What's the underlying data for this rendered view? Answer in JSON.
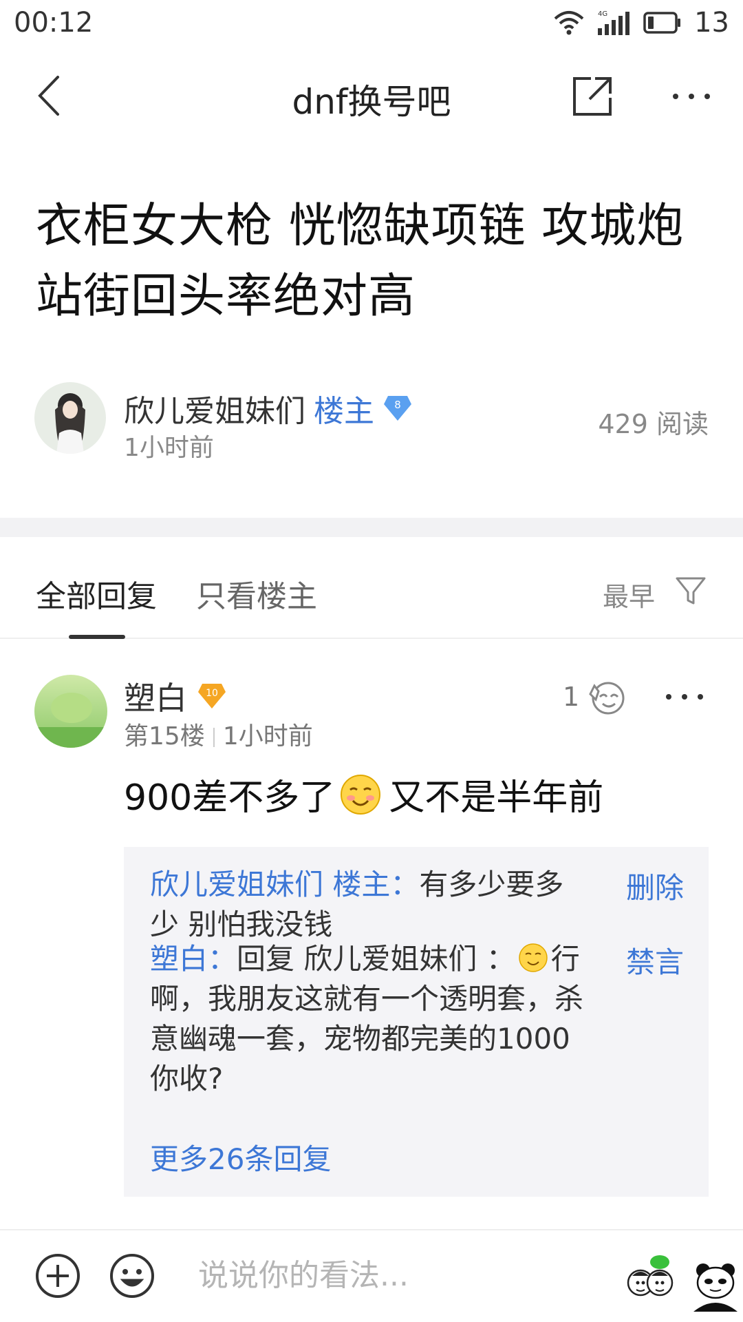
{
  "status_bar": {
    "time": "00:12",
    "battery": "13",
    "network": "4G"
  },
  "nav": {
    "title": "dnf换号吧"
  },
  "post": {
    "title": "衣柜女大枪 恍惚缺项链 攻城炮站街回头率绝对高",
    "author": {
      "name": "欣儿爱姐妹们",
      "tag": "楼主",
      "level": "8",
      "time": "1小时前"
    },
    "read_count": "429 阅读"
  },
  "tabs": {
    "all": "全部回复",
    "lz_only": "只看楼主",
    "sort": "最早"
  },
  "reply": {
    "name": "塑白",
    "level": "10",
    "floor": "第15楼",
    "time": "1小时前",
    "likes": "1",
    "content_a": "900差不多了",
    "content_b": "又不是半年前",
    "sub_replies": [
      {
        "who": "欣儿爱姐妹们 楼主：",
        "text": "有多少要多少 别怕我没钱",
        "action": "删除"
      },
      {
        "who": "塑白：",
        "text_a": "回复 欣儿爱姐妹们 ：",
        "text_b": "行啊，我朋友这就有一个透明套，杀意幽魂一套，宠物都完美的1000你收?",
        "action": "禁言"
      }
    ],
    "more": "更多26条回复"
  },
  "bottom": {
    "placeholder": "说说你的看法..."
  },
  "colors": {
    "link_blue": "#3d77d6",
    "badge_blue": "#5aa0f0",
    "badge_orange": "#f5a623"
  },
  "icons": [
    "wifi-icon",
    "signal-icon",
    "battery-icon",
    "back-icon",
    "share-icon",
    "more-icon",
    "filter-icon",
    "like-icon",
    "plus-icon",
    "emoji-icon"
  ]
}
